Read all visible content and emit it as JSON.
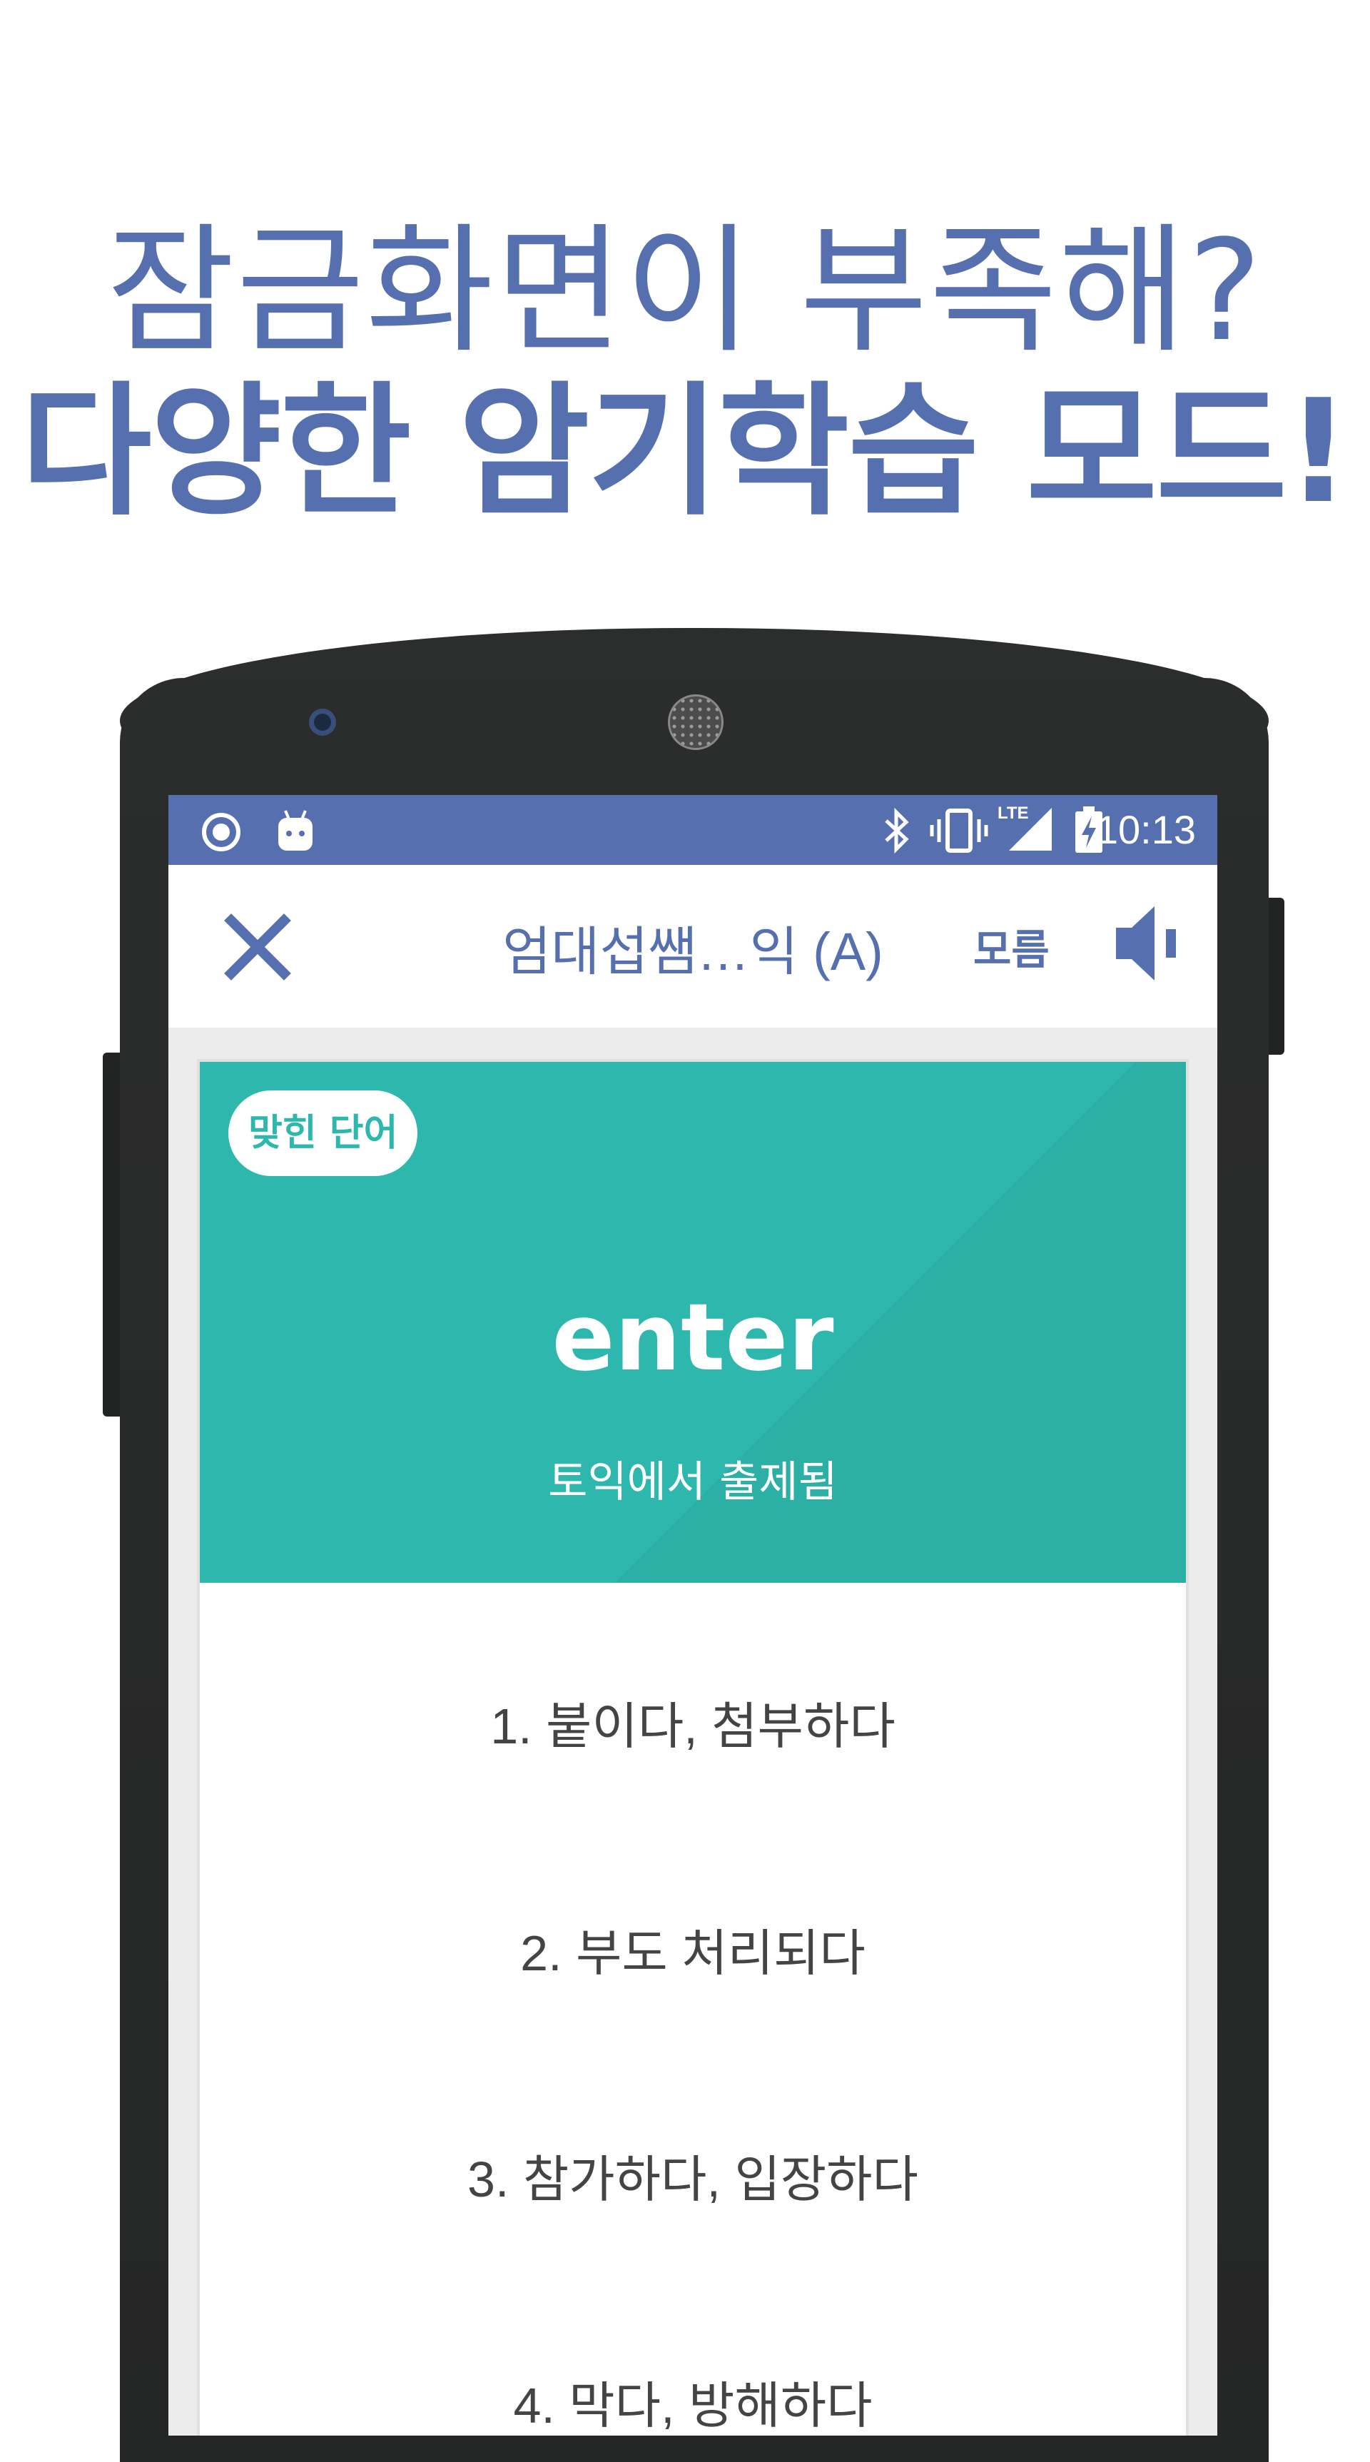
{
  "headline": {
    "line1": "잠금화면이 부족해?",
    "line2": "다양한 암기학습 모드!"
  },
  "colors": {
    "brand": "#5670AF",
    "teal": "#2EB8AD",
    "phone": "#2c2d2d"
  },
  "status_bar": {
    "left_icons": [
      "circle-app-icon",
      "android-icon"
    ],
    "right_icons": [
      "bluetooth-icon",
      "vibrate-icon",
      "lte-signal-icon",
      "battery-charging-icon"
    ],
    "lte_label": "LTE",
    "time": "10:13"
  },
  "app_bar": {
    "close_icon": "close-icon",
    "title": "엄대섭쌤…익 (A)",
    "unknown_label": "모름",
    "sound_icon": "speaker-icon"
  },
  "card": {
    "badge": "맞힌 단어",
    "word": "enter",
    "note": "토익에서 출제됨",
    "options": [
      "1.  붙이다, 첨부하다",
      "2.  부도 처리되다",
      "3.  참가하다, 입장하다",
      "4.  막다, 방해하다"
    ]
  }
}
